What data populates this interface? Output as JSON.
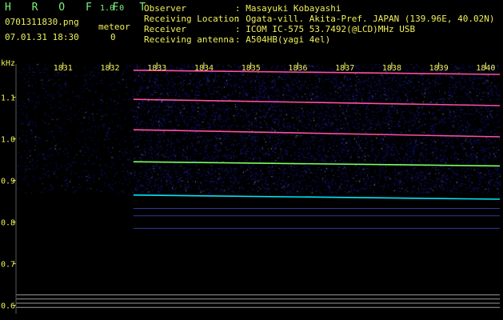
{
  "app": {
    "title": "H R O F F T",
    "version": "1.0.0",
    "filename": "0701311830.png",
    "meteor_label": "meteor",
    "meteor_count": "0",
    "datetime": "07.01.31 18:30"
  },
  "info": {
    "rows": [
      {
        "key": "Observer",
        "value": ": Masayuki Kobayashi"
      },
      {
        "key": "Receiving Location",
        "value": ": Ogata-vill. Akita-Pref. JAPAN (139.96E, 40.02N)"
      },
      {
        "key": "Receiver",
        "value": ": ICOM IC-575 53.7492(@LCD)MHz USB"
      },
      {
        "key": "Receiving antenna",
        "value": ": A504HB(yagi 4el)"
      }
    ]
  },
  "colors": {
    "background": "#000000",
    "header_text": "#f0f05a",
    "brand_text": "#7cf07c",
    "trace_pink": "#ff4fa0",
    "trace_cyan": "#00e5ff",
    "trace_green": "#7cff5a",
    "noise_blue": "#1f2cff"
  },
  "chart_data": {
    "type": "heatmap",
    "yunit": "kHz",
    "x_ticks": [
      "1831",
      "1832",
      "1833",
      "1834",
      "1835",
      "1836",
      "1837",
      "1838",
      "1839",
      "1840"
    ],
    "y_ticks": [
      "1.1",
      "1.0",
      "0.9",
      "0.8",
      "0.7",
      "0.6"
    ],
    "ylim": [
      0.58,
      1.18
    ],
    "x_start_minute": 1830.0,
    "x_end_minute": 1840.3,
    "signal_start_minute": 1832.5,
    "traces": [
      {
        "color": "trace_pink",
        "start_khz": 1.165,
        "end_khz": 1.155
      },
      {
        "color": "trace_pink",
        "start_khz": 1.095,
        "end_khz": 1.08
      },
      {
        "color": "trace_pink",
        "start_khz": 1.022,
        "end_khz": 1.005
      },
      {
        "color": "trace_green",
        "start_khz": 0.945,
        "end_khz": 0.935
      },
      {
        "color": "trace_cyan",
        "start_khz": 0.865,
        "end_khz": 0.855
      }
    ],
    "faint_lines_khz": [
      0.833,
      0.815,
      0.785
    ],
    "horizontal_rules_khz": [
      0.625,
      0.615,
      0.605,
      0.595
    ]
  }
}
